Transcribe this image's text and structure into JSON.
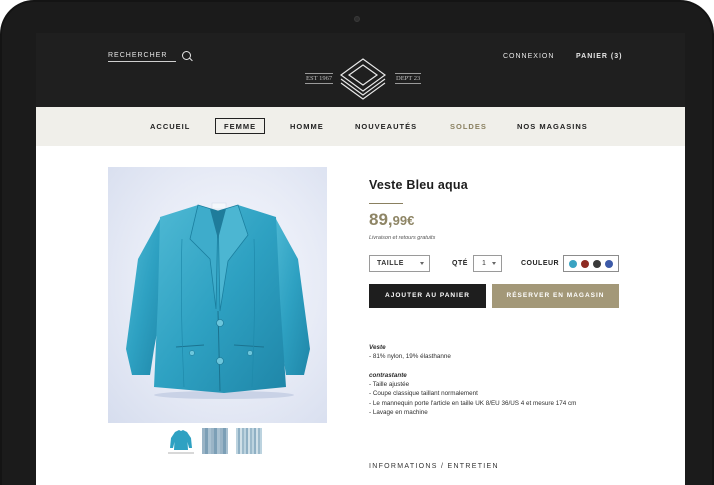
{
  "header": {
    "search_label": "RECHERCHER",
    "login": "CONNEXION",
    "cart": "PANIER (3)",
    "logo_year": "EST 1967",
    "logo_dept": "DEPT 23"
  },
  "nav": {
    "items": [
      {
        "label": "ACCUEIL"
      },
      {
        "label": "FEMME",
        "active": true
      },
      {
        "label": "HOMME"
      },
      {
        "label": "NOUVEAUTÉS"
      },
      {
        "label": "SOLDES"
      },
      {
        "label": "NOS MAGASINS"
      }
    ]
  },
  "product": {
    "title": "Veste Bleu aqua",
    "price_int": "89,",
    "price_dec": "99€",
    "delivery": "Livraison et retours gratuits",
    "size_value": "TAILLE",
    "qty_label": "QTÉ",
    "qty_value": "1",
    "color_label": "COULEUR",
    "colors": [
      "#3aa3c2",
      "#8e2a22",
      "#3a3a3a",
      "#3d5aa8"
    ],
    "add_to_cart": "AJOUTER AU PANIER",
    "reserve": "RÉSERVER EN MAGASIN",
    "description": {
      "heading1": "Veste",
      "line1": "- 81% nylon, 19% élasthanne",
      "heading2": "contrastante",
      "bullets": [
        "- Taille ajustée",
        "- Coupe classique taillant normalement",
        "- Le mannequin porte l'article en taille UK 8/EU 36/US 4 et mesure 174 cm",
        "- Lavage en machine"
      ]
    },
    "info_tab": "INFORMATIONS / ENTRETIEN"
  }
}
